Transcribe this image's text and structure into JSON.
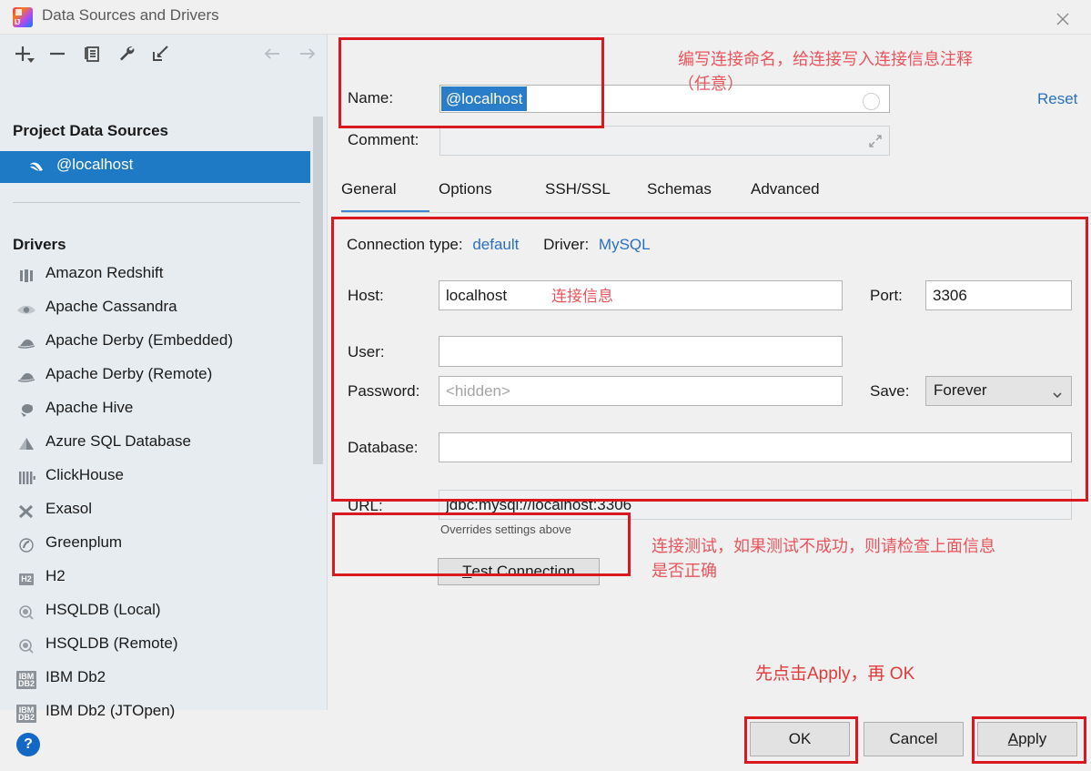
{
  "window": {
    "title": "Data Sources and Drivers",
    "logo_icon": "intellij-logo-icon",
    "close_icon": "close-icon"
  },
  "toolbar": {
    "add_icon": "plus-icon",
    "remove_icon": "minus-icon",
    "copy_icon": "copy-icon",
    "settings_icon": "wrench-icon",
    "import_icon": "import-arrow-icon",
    "back_icon": "arrow-left-icon",
    "forward_icon": "arrow-right-icon"
  },
  "sidebar": {
    "project_heading": "Project Data Sources",
    "data_sources": [
      {
        "label": "@localhost",
        "icon": "mysql-dolphin-icon",
        "selected": true
      }
    ],
    "drivers_heading": "Drivers",
    "drivers": [
      {
        "label": "Amazon Redshift",
        "icon": "redshift-icon",
        "glyph": "▯▯▯"
      },
      {
        "label": "Apache Cassandra",
        "icon": "cassandra-eye-icon",
        "glyph": "◠"
      },
      {
        "label": "Apache Derby (Embedded)",
        "icon": "derby-hat-icon",
        "glyph": "☂"
      },
      {
        "label": "Apache Derby (Remote)",
        "icon": "derby-hat-icon",
        "glyph": "☂"
      },
      {
        "label": "Apache Hive",
        "icon": "hive-bee-icon",
        "glyph": "✾"
      },
      {
        "label": "Azure SQL Database",
        "icon": "azure-icon",
        "glyph": "◮"
      },
      {
        "label": "ClickHouse",
        "icon": "clickhouse-icon",
        "glyph": "||||"
      },
      {
        "label": "Exasol",
        "icon": "exasol-x-icon",
        "glyph": "X"
      },
      {
        "label": "Greenplum",
        "icon": "greenplum-icon",
        "glyph": "◎"
      },
      {
        "label": "H2",
        "icon": "h2-icon",
        "glyph": "H2"
      },
      {
        "label": "HSQLDB (Local)",
        "icon": "hsqldb-icon",
        "glyph": "◉"
      },
      {
        "label": "HSQLDB (Remote)",
        "icon": "hsqldb-icon",
        "glyph": "◉"
      },
      {
        "label": "IBM Db2",
        "icon": "ibm-db2-icon",
        "glyph": "IBM"
      },
      {
        "label": "IBM Db2 (JTOpen)",
        "icon": "ibm-db2-icon",
        "glyph": "IBM"
      }
    ],
    "scrollbar": "vertical-scrollbar",
    "help_icon": "help-question-icon",
    "help_label": "?"
  },
  "detail": {
    "name_label": "Name:",
    "name_value": "@localhost",
    "name_refresh_icon": "refresh-circle-icon",
    "comment_label": "Comment:",
    "comment_value": "",
    "comment_expand_icon": "expand-icon",
    "reset_label": "Reset",
    "tabs": [
      {
        "label": "General",
        "active": true
      },
      {
        "label": "Options",
        "active": false
      },
      {
        "label": "SSH/SSL",
        "active": false
      },
      {
        "label": "Schemas",
        "active": false
      },
      {
        "label": "Advanced",
        "active": false
      }
    ],
    "connection_type_label": "Connection type:",
    "connection_type_value": "default",
    "driver_label": "Driver:",
    "driver_value": "MySQL",
    "host_label": "Host:",
    "host_value": "localhost",
    "port_label": "Port:",
    "port_value": "3306",
    "user_label": "User:",
    "user_value": "",
    "password_label": "Password:",
    "password_placeholder": "<hidden>",
    "save_label": "Save:",
    "save_value": "Forever",
    "save_chevron_icon": "chevron-down-icon",
    "database_label": "Database:",
    "database_value": "",
    "url_label": "URL:",
    "url_value": "jdbc:mysql://localhost:3306",
    "url_hint": "Overrides settings above",
    "test_connection_label": "Test Connection",
    "test_connection_mnemonic": "T"
  },
  "footer": {
    "ok_label": "OK",
    "cancel_label": "Cancel",
    "apply_label": "Apply",
    "apply_mnemonic": "A"
  },
  "annotations": {
    "name_note": "编写连接命名，给连接写入连接信息注释\n（任意）",
    "conn_info_note": "连接信息",
    "test_note": "连接测试，如果测试不成功，则请检查上面信息\n是否正确",
    "apply_note": "先点击Apply，再 OK",
    "box_color": "#d9191f",
    "text_color": "#e8555c"
  },
  "colors": {
    "accent_blue": "#1e7ac4",
    "link_blue": "#2a6fc4",
    "panel_bg": "#e7ecf0",
    "dialog_bg": "#f0f0f0",
    "annotation_red": "#d9191f"
  }
}
